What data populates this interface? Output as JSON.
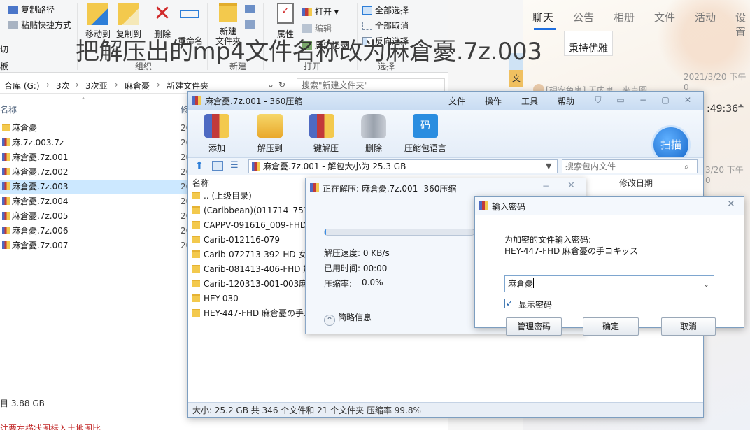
{
  "caption": "把解压出的mp4文件名称改为麻倉憂.7z.003",
  "explorer": {
    "ribbon": {
      "copy_path": "复制路径",
      "paste_shortcut": "粘贴快捷方式",
      "move_to": "移动到",
      "copy_to": "复制到",
      "delete": "删除",
      "rename": "重命名",
      "new_folder": "新建\n文件夹",
      "properties": "属性",
      "open": "打开",
      "edit": "编辑",
      "history": "历史记录",
      "select_all": "全部选择",
      "select_none": "全部取消",
      "invert_select": "反向选择",
      "group_organize": "组织",
      "group_new": "新建",
      "group_open": "打开",
      "group_select": "选择",
      "left_cut": "切",
      "left_edge": "板"
    },
    "breadcrumb": [
      "合库 (G:)",
      "3次",
      "3次亚",
      "麻倉憂",
      "新建文件夹"
    ],
    "search_placeholder": "搜索\"新建文件夹\"",
    "column_name": "名称",
    "column_modified": "修",
    "files": [
      {
        "name": "麻倉憂",
        "type": "folder",
        "date": "20"
      },
      {
        "name": "麻.7z.003.7z",
        "type": "rar",
        "date": "20"
      },
      {
        "name": "麻倉憂.7z.001",
        "type": "rar",
        "date": "20"
      },
      {
        "name": "麻倉憂.7z.002",
        "type": "rar",
        "date": "20"
      },
      {
        "name": "麻倉憂.7z.003",
        "type": "rar",
        "date": "20",
        "selected": true
      },
      {
        "name": "麻倉憂.7z.004",
        "type": "rar",
        "date": "20"
      },
      {
        "name": "麻倉憂.7z.005",
        "type": "rar",
        "date": "20"
      },
      {
        "name": "麻倉憂.7z.006",
        "type": "rar",
        "date": "20"
      },
      {
        "name": "麻倉憂.7z.007",
        "type": "rar",
        "date": "20"
      }
    ],
    "status": "目 3.88 GB",
    "red_note": "注要左横状图标入土地图比"
  },
  "chat": {
    "tabs": [
      "聊天",
      "公告",
      "相册",
      "文件",
      "活动",
      "设置"
    ],
    "card_text": "秉持优雅",
    "stamp1": "2021/3/20 下午 0",
    "stamp2": "3/20 下午 0",
    "clock": ":49:36",
    "msg": "[相安色鬼] 无内鬼，来点图"
  },
  "mid": {
    "tab_label": "文"
  },
  "zip": {
    "title": "麻倉憂.7z.001 - 360压缩",
    "menu": [
      "文件",
      "操作",
      "工具",
      "帮助"
    ],
    "tools": [
      "添加",
      "解压到",
      "一键解压",
      "删除",
      "压缩包语言"
    ],
    "scan": "扫描",
    "path": "麻倉憂.7z.001 - 解包大小为 25.3 GB",
    "search_placeholder": "搜索包内文件",
    "col_name": "名称",
    "col_modified": "修改日期",
    "entries": [
      ".. (上级目录)",
      "(Caribbean)(011714_751)",
      "CAPPV-091616_009-FHD",
      "Carib-012116-079",
      "Carib-072713-392-HD  女",
      "Carib-081413-406-FHD  加",
      "Carib-120313-001-003麻",
      "HEY-030",
      "HEY-447-FHD 麻倉憂の手..."
    ],
    "status": "大小: 25.2 GB 共 346 个文件和 21 个文件夹 压缩率 99.8%"
  },
  "progress": {
    "title": "正在解压: 麻倉憂.7z.001 -360压缩",
    "fraction": 0.01,
    "speed_label": "解压速度: 0 KB/s",
    "elapsed_label": "已用时间: 00:00",
    "ratio_label": "压缩率:",
    "ratio_value": "0.0%",
    "info": "简略信息"
  },
  "password": {
    "title": "输入密码",
    "prompt": "为加密的文件输入密码:",
    "filename": "HEY-447-FHD 麻倉憂の手コキッス",
    "value": "麻倉憂",
    "show_label": "显示密码",
    "show_checked": "✓",
    "manage": "管理密码",
    "ok": "确定",
    "cancel": "取消"
  }
}
